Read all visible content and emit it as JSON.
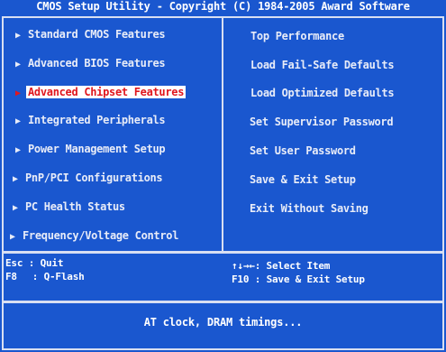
{
  "title": "CMOS Setup Utility - Copyright (C) 1984-2005 Award Software",
  "left_menu": [
    {
      "label": "Standard CMOS Features"
    },
    {
      "label": "Advanced BIOS Features"
    },
    {
      "label": "Advanced Chipset Features"
    },
    {
      "label": "Integrated Peripherals"
    },
    {
      "label": "Power Management Setup"
    },
    {
      "label": "PnP/PCI Configurations"
    },
    {
      "label": "PC Health Status"
    },
    {
      "label": "Frequency/Voltage Control"
    }
  ],
  "right_menu": [
    {
      "label": "Top Performance"
    },
    {
      "label": "Load Fail-Safe Defaults"
    },
    {
      "label": "Load Optimized Defaults"
    },
    {
      "label": "Set Supervisor Password"
    },
    {
      "label": "Set User Password"
    },
    {
      "label": "Save & Exit Setup"
    },
    {
      "label": "Exit Without Saving"
    }
  ],
  "selected_item": "Advanced Chipset Features",
  "arrow_glyph": "▶",
  "help": {
    "esc_key": "Esc",
    "esc_action": ": Quit",
    "f8_key": "F8",
    "f8_action": ": Q-Flash",
    "arrows_key": "↑↓→←",
    "arrows_action": ": Select Item",
    "f10_key": "F10",
    "f10_action": ": Save & Exit Setup"
  },
  "status_text": "AT clock, DRAM timings...",
  "colors": {
    "background": "#1a57cf",
    "border": "#d8dff2",
    "highlight_bg": "#ffffff",
    "highlight_fg": "#e0171e"
  }
}
